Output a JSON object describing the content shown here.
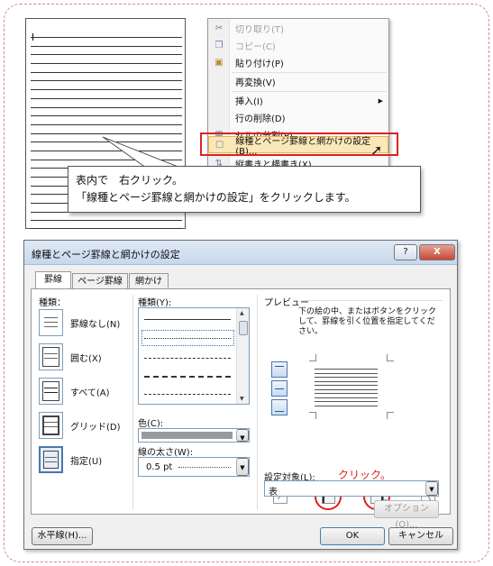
{
  "context_menu": {
    "items": [
      {
        "label": "切り取り(T)",
        "icon": "scissors-icon",
        "disabled": true
      },
      {
        "label": "コピー(C)",
        "icon": "copy-icon",
        "disabled": true
      },
      {
        "label": "貼り付け(P)",
        "icon": "paste-icon",
        "disabled": false
      },
      {
        "label": "再変換(V)",
        "icon": "",
        "disabled": false
      },
      {
        "label": "挿入(I)",
        "icon": "",
        "disabled": false
      },
      {
        "label": "行の削除(D)",
        "icon": "",
        "disabled": false
      },
      {
        "label": "セルの分割(P)...",
        "icon": "split-cells-icon",
        "disabled": false
      },
      {
        "label": "線種とページ罫線と網かけの設定(B)...",
        "icon": "borders-icon",
        "disabled": false
      },
      {
        "label": "縦書きと横書き(X)...",
        "icon": "text-direction-icon",
        "disabled": false
      }
    ]
  },
  "callout": {
    "line1": "表内で　右クリック。",
    "line2": "「線種とページ罫線と網かけの設定」をクリックします。"
  },
  "dialog": {
    "title": "線種とページ罫線と網かけの設定",
    "help_label": "?",
    "close_label": "X",
    "tabs": [
      "罫線",
      "ページ罫線",
      "網かけ"
    ],
    "setting_label": "種類：",
    "settings": [
      "罫線なし(N)",
      "囲む(X)",
      "すべて(A)",
      "グリッド(D)",
      "指定(U)"
    ],
    "line_style_label": "種類(Y):",
    "color_label": "色(C):",
    "width_label": "線の太さ(W):",
    "width_value": "0.5 pt",
    "preview_label": "プレビュー",
    "preview_hint": "下の絵の中、またはボタンをクリックして、罫線を引く位置を指定してください。",
    "apply_to_label": "設定対象(L):",
    "apply_to_value": "表",
    "options_button": "オプション(O)...",
    "horizontal_line_button": "水平線(H)...",
    "ok_button": "OK",
    "cancel_button": "キャンセル"
  },
  "annotation": {
    "click_text": "クリック。"
  },
  "colors": {
    "highlight_red": "#e02020",
    "menu_highlight": "#fce7b8",
    "accent_blue": "#4a78b0"
  }
}
